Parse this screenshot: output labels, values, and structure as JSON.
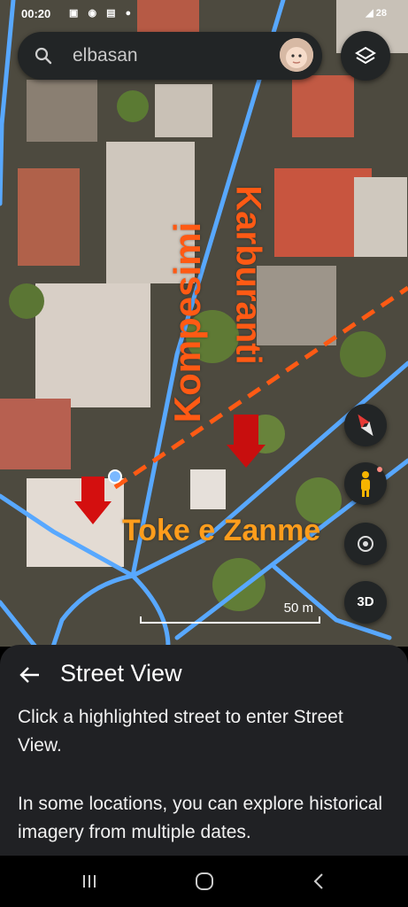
{
  "status_bar": {
    "time": "00:20",
    "notification_icons": "▣ ◉ ▤ ●",
    "right_icons": "◢ 28"
  },
  "search": {
    "value": "elbasan",
    "icon": "search-icon"
  },
  "annotations": {
    "vertical_left": "Kompesimi",
    "vertical_right": "Karburanti",
    "horizontal": "Toke e Zanme"
  },
  "map": {
    "scale_label": "50 m",
    "three_d_label": "3D",
    "accent_street_color": "#58a8ff",
    "annotation_color": "#ff5a14"
  },
  "sheet": {
    "title": "Street View",
    "paragraph1": "Click a highlighted street to enter Street View.",
    "paragraph2": "In some locations, you can explore historical imagery from multiple dates."
  }
}
